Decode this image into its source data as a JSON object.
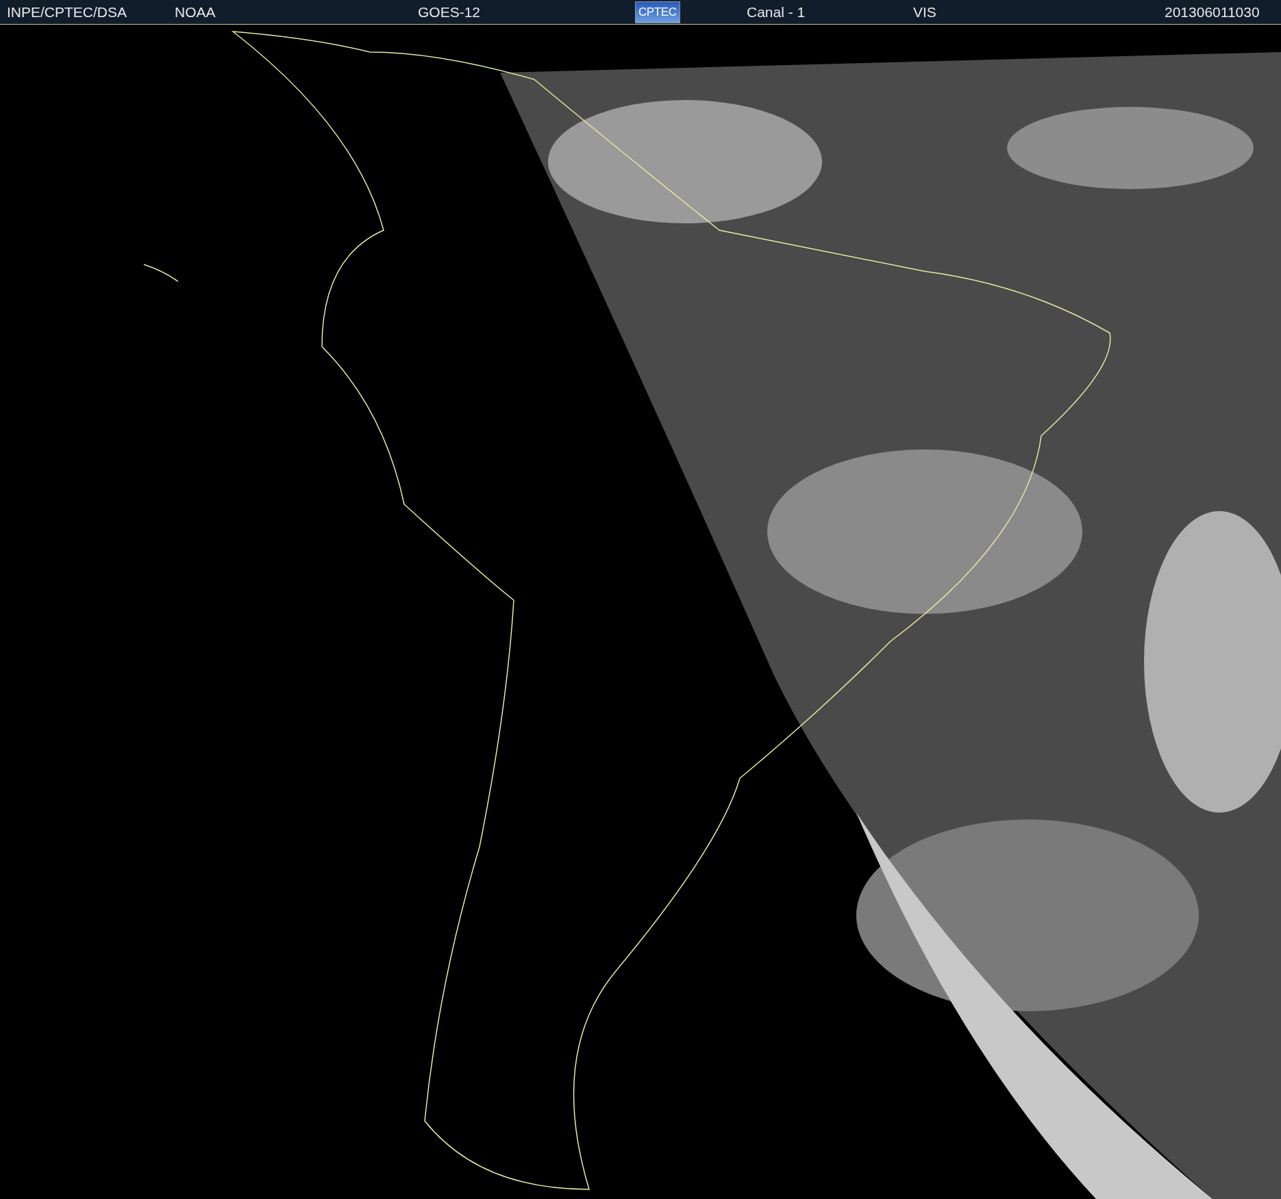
{
  "header": {
    "items": [
      {
        "kind": "text",
        "text": "INPE/CPTEC/DSA"
      },
      {
        "kind": "text",
        "text": "NOAA"
      },
      {
        "kind": "text",
        "text": "GOES-12"
      },
      {
        "kind": "logo",
        "text": "CPTEC"
      },
      {
        "kind": "text",
        "text": "Canal - 1"
      },
      {
        "kind": "text",
        "text": "VIS"
      },
      {
        "kind": "text",
        "text": "201306011030"
      }
    ]
  }
}
